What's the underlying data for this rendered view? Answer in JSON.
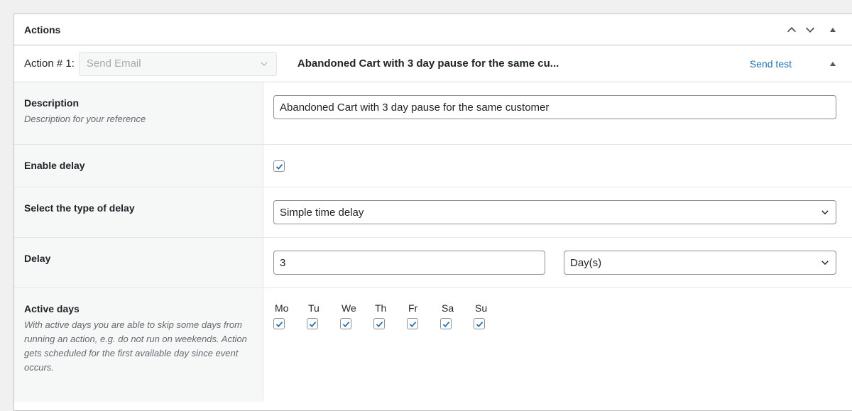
{
  "panel": {
    "title": "Actions"
  },
  "action": {
    "label": "Action # 1:",
    "type_select_value": "Send Email",
    "summary": "Abandoned Cart with 3 day pause for the same cu...",
    "send_test_label": "Send test"
  },
  "fields": {
    "description": {
      "title": "Description",
      "help": "Description for your reference",
      "value": "Abandoned Cart with 3 day pause for the same customer"
    },
    "enable_delay": {
      "title": "Enable delay",
      "checked": true
    },
    "delay_type": {
      "title": "Select the type of delay",
      "value": "Simple time delay"
    },
    "delay": {
      "title": "Delay",
      "amount": "3",
      "unit": "Day(s)"
    },
    "active_days": {
      "title": "Active days",
      "help": "With active days you are able to skip some days from running an action, e.g. do not run on weekends. Action gets scheduled for the first available day since event occurs.",
      "days": [
        {
          "label": "Mo",
          "checked": true
        },
        {
          "label": "Tu",
          "checked": true
        },
        {
          "label": "We",
          "checked": true
        },
        {
          "label": "Th",
          "checked": true
        },
        {
          "label": "Fr",
          "checked": true
        },
        {
          "label": "Sa",
          "checked": true
        },
        {
          "label": "Su",
          "checked": true
        }
      ]
    }
  },
  "icons": {
    "move_up": "chevron-up-icon",
    "move_down": "chevron-down-icon",
    "toggle": "triangle-up-icon",
    "checkmark": "check-icon"
  },
  "colors": {
    "link": "#2271b1",
    "checkbox_check": "#2271b1",
    "label_bg": "#f6f7f7"
  }
}
